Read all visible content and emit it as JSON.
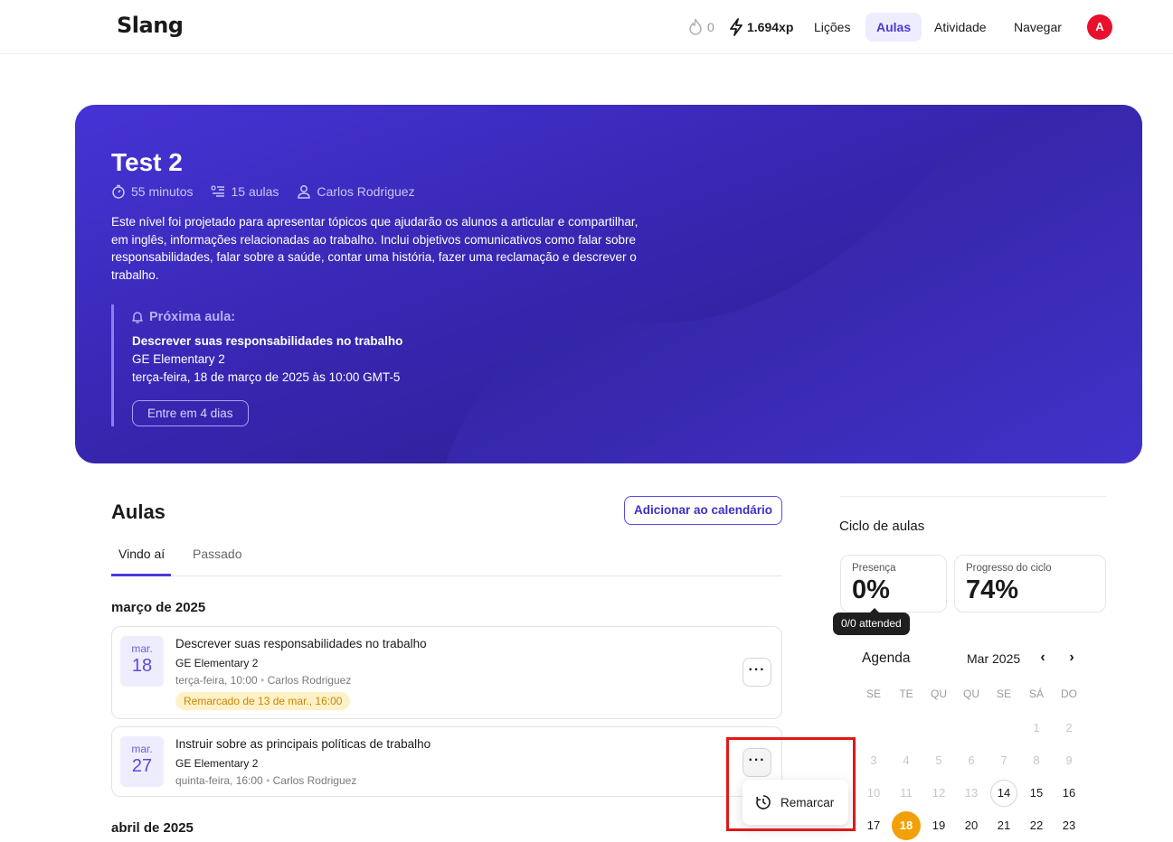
{
  "header": {
    "logo": "Slang",
    "streak_count": "0",
    "xp": "1.694xp",
    "nav": [
      "Lições",
      "Aulas",
      "Atividade",
      "Navegar"
    ],
    "active_nav": "Aulas",
    "avatar_letter": "A",
    "colors": {
      "accent": "#4a3ad8",
      "avatar": "#e8102c"
    }
  },
  "hero": {
    "title": "Test 2",
    "duration": "55 minutos",
    "lessons_count": "15 aulas",
    "teacher": "Carlos Rodriguez",
    "description": "Este nível foi projetado para apresentar tópicos que ajudarão os alunos a articular e compartilhar, em inglês, informações relacionadas ao trabalho. Inclui objetivos comunicativos como falar sobre responsabilidades, falar sobre a saúde, contar uma história, fazer uma reclamação e descrever o trabalho.",
    "next": {
      "label": "Próxima aula:",
      "lesson": "Descrever suas responsabilidades no trabalho",
      "level": "GE Elementary 2",
      "datetime": "terça-feira, 18 de março de 2025 às 10:00 GMT-5",
      "join_label": "Entre em 4 dias"
    }
  },
  "aulas": {
    "title": "Aulas",
    "add_calendar_label": "Adicionar ao calendário",
    "tabs": [
      "Vindo aí",
      "Passado"
    ],
    "groups": [
      {
        "month": "março de 2025",
        "lessons": [
          {
            "month_abbr": "mar.",
            "day": "18",
            "title": "Descrever suas responsabilidades no trabalho",
            "level": "GE Elementary 2",
            "time": "terça-feira, 10:00",
            "teacher": "Carlos Rodriguez",
            "badge": "Remarcado de 13 de mar., 16:00"
          },
          {
            "month_abbr": "mar.",
            "day": "27",
            "title": "Instruir sobre as principais políticas de trabalho",
            "level": "GE Elementary 2",
            "time": "quinta-feira, 16:00",
            "teacher": "Carlos Rodriguez"
          }
        ]
      },
      {
        "month": "abril de 2025"
      }
    ],
    "menu": {
      "reschedule_label": "Remarcar"
    }
  },
  "cycle": {
    "title": "Ciclo de aulas",
    "attendance_label": "Presença",
    "attendance_value": "0%",
    "attendance_tooltip": "0/0 attended",
    "progress_label": "Progresso do ciclo",
    "progress_value": "74%"
  },
  "agenda": {
    "title": "Agenda",
    "month": "Mar 2025",
    "weekdays": [
      "SE",
      "TE",
      "QU",
      "QU",
      "SE",
      "SÁ",
      "DO"
    ],
    "weeks": [
      [
        "",
        "",
        "",
        "",
        "",
        "1",
        "2"
      ],
      [
        "3",
        "4",
        "5",
        "6",
        "7",
        "8",
        "9"
      ],
      [
        "10",
        "11",
        "12",
        "13",
        "14",
        "15",
        "16"
      ],
      [
        "17",
        "18",
        "19",
        "20",
        "21",
        "22",
        "23"
      ]
    ],
    "today": "14",
    "selected": "18",
    "selected_color": "#f2a007"
  }
}
